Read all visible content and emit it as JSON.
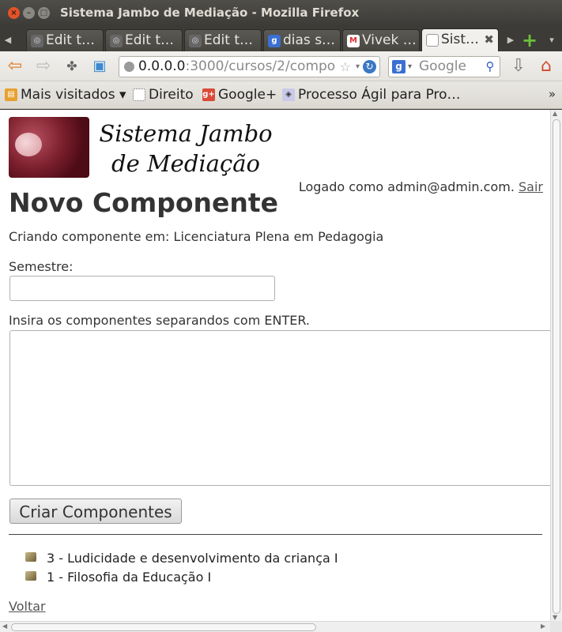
{
  "window": {
    "title": "Sistema Jambo de Mediação - Mozilla Firefox"
  },
  "tabs": [
    {
      "label": "Edit t…",
      "icon": "github-icon",
      "active": false
    },
    {
      "label": "Edit t…",
      "icon": "github-icon",
      "active": false
    },
    {
      "label": "Edit t…",
      "icon": "github-icon",
      "active": false
    },
    {
      "label": "dias s…",
      "icon": "google-icon",
      "active": false
    },
    {
      "label": "Vivek …",
      "icon": "gmail-icon",
      "active": false
    },
    {
      "label": "Sist…",
      "icon": "page-icon",
      "active": true
    }
  ],
  "nav": {
    "url_host": "0.0.0.0",
    "url_rest": ":3000/cursos/2/compo",
    "search_placeholder": "Google"
  },
  "bookmarks": [
    {
      "label": "Mais visitados ▾",
      "icon": "most-visited-icon"
    },
    {
      "label": "Direito",
      "icon": "page-icon"
    },
    {
      "label": "Google+",
      "icon": "google-plus-icon"
    },
    {
      "label": "Processo Ágil para Pro…",
      "icon": "bookmark-icon"
    }
  ],
  "page": {
    "logo_text_line1": "Sistema Jambo",
    "logo_text_line2": "de Mediação",
    "logged_as": "Logado como admin@admin.com.",
    "logout_label": "Sair",
    "title": "Novo Componente",
    "context": "Criando componente em: Licenciatura Plena em Pedagogia",
    "semester_label": "Semestre:",
    "semester_value": "",
    "components_label": "Insira os componentes separandos com ENTER.",
    "components_value": "",
    "submit_label": "Criar Componentes",
    "components": [
      "3 - Ludicidade e desenvolvimento da criança I",
      "1 - Filosofia da Educação I"
    ],
    "back_label": "Voltar"
  },
  "colors": {
    "titlebar": "#3c3b37",
    "close_button": "#e2532a",
    "link": "#555555"
  }
}
